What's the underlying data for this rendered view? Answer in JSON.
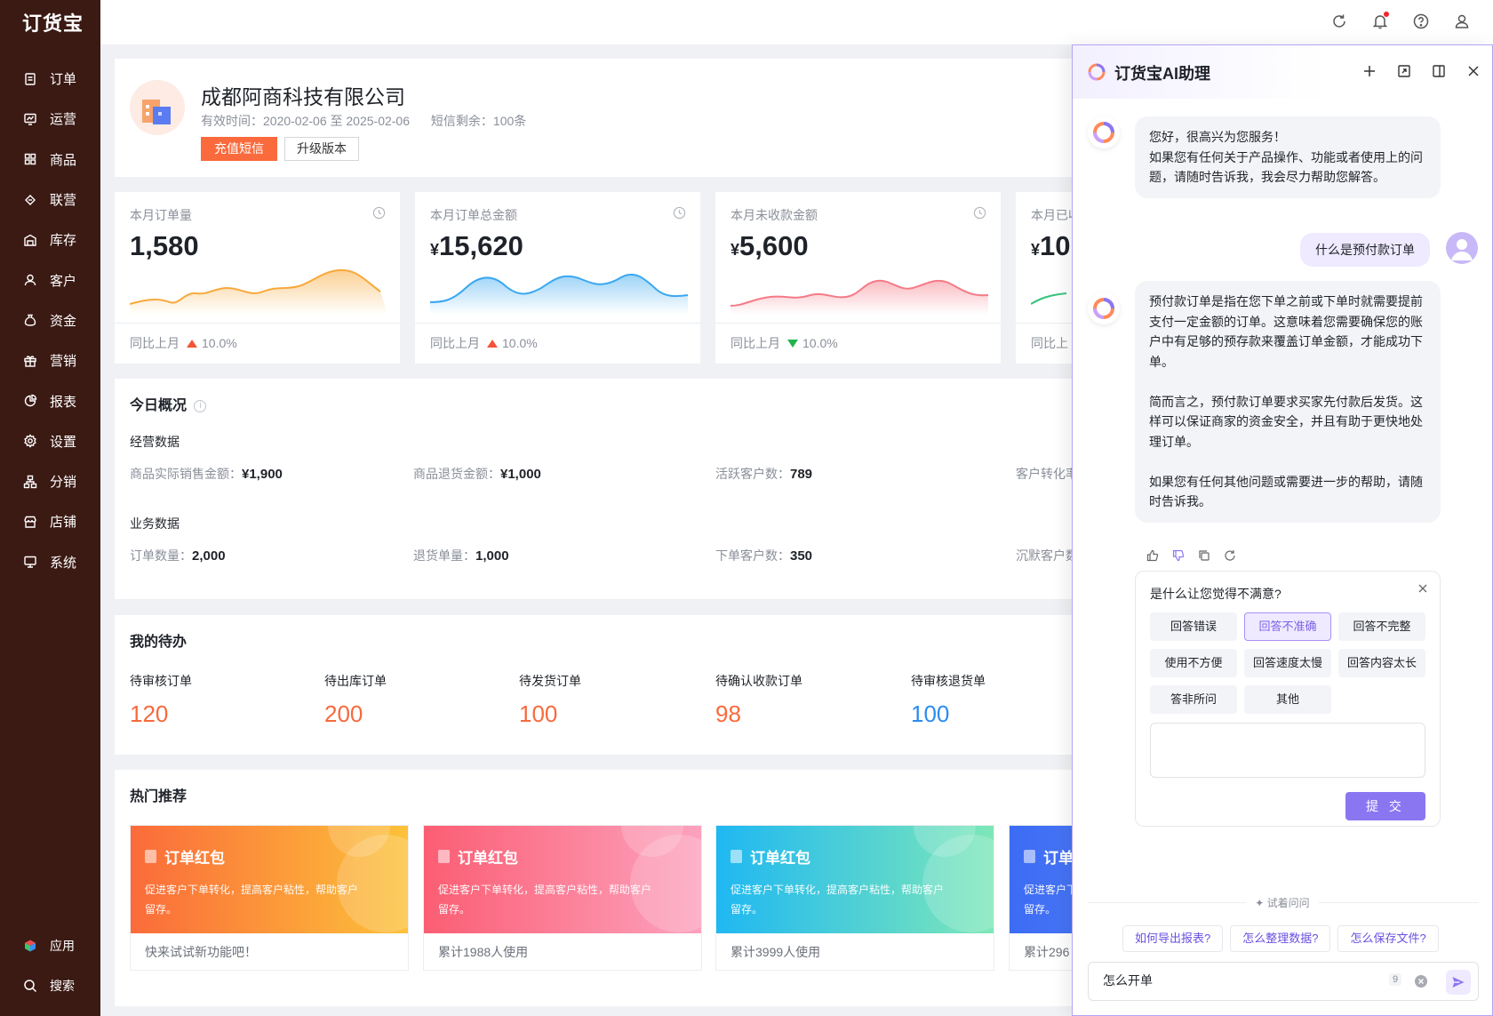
{
  "app": {
    "logo": "订货宝"
  },
  "sidebar": {
    "items": [
      {
        "label": "订单",
        "icon": "order-icon"
      },
      {
        "label": "运营",
        "icon": "operation-icon"
      },
      {
        "label": "商品",
        "icon": "goods-icon"
      },
      {
        "label": "联营",
        "icon": "joint-icon"
      },
      {
        "label": "库存",
        "icon": "warehouse-icon"
      },
      {
        "label": "客户",
        "icon": "customer-icon"
      },
      {
        "label": "资金",
        "icon": "money-bag-icon"
      },
      {
        "label": "营销",
        "icon": "gift-icon"
      },
      {
        "label": "报表",
        "icon": "pie-chart-icon"
      },
      {
        "label": "设置",
        "icon": "gear-icon"
      },
      {
        "label": "分销",
        "icon": "distribution-icon"
      },
      {
        "label": "店铺",
        "icon": "shop-icon"
      },
      {
        "label": "系统",
        "icon": "monitor-icon"
      }
    ],
    "bottom": [
      {
        "label": "应用",
        "icon": "apps-cube-icon"
      },
      {
        "label": "搜索",
        "icon": "search-icon"
      }
    ]
  },
  "topbar": {
    "icons": [
      "refresh-icon",
      "bell-icon",
      "help-icon",
      "user-icon"
    ]
  },
  "company": {
    "name": "成都阿商科技有限公司",
    "valid_time": "有效时间：2020-02-06 至 2025-02-06",
    "sms_left": "短信剩余：100条",
    "recharge_btn": "充值短信",
    "upgrade_btn": "升级版本"
  },
  "stats": [
    {
      "label": "本月订单量",
      "value": "1,580",
      "prefix": "",
      "compare": "同比上月",
      "trend": "up",
      "pct": "10.0%",
      "color": "#f7a93b"
    },
    {
      "label": "本月订单总金额",
      "value": "15,620",
      "prefix": "¥",
      "compare": "同比上月",
      "trend": "up",
      "pct": "10.0%",
      "color": "#3aa7f0"
    },
    {
      "label": "本月未收款金额",
      "value": "5,600",
      "prefix": "¥",
      "compare": "同比上月",
      "trend": "down",
      "pct": "10.0%",
      "color": "#f57a86"
    },
    {
      "label": "本月已收",
      "value": "10",
      "prefix": "¥",
      "compare": "同比上",
      "trend": "up",
      "pct": "",
      "color": "#33c27a"
    }
  ],
  "today": {
    "title": "今日概况",
    "business_title": "经营数据",
    "business": [
      {
        "label": "商品实际销售金额：",
        "value": "¥1,900"
      },
      {
        "label": "商品退货金额：",
        "value": "¥1,000"
      },
      {
        "label": "活跃客户数：",
        "value": "789"
      },
      {
        "label": "客户转化率",
        "value": ""
      }
    ],
    "service_title": "业务数据",
    "service": [
      {
        "label": "订单数量：",
        "value": "2,000"
      },
      {
        "label": "退货单量：",
        "value": "1,000"
      },
      {
        "label": "下单客户数：",
        "value": "350"
      },
      {
        "label": "沉默客户数",
        "value": ""
      }
    ]
  },
  "todo": {
    "title": "我的待办",
    "items": [
      {
        "label": "待审核订单",
        "value": "120",
        "color": "#f76a3c"
      },
      {
        "label": "待出库订单",
        "value": "200",
        "color": "#f76a3c"
      },
      {
        "label": "待发货订单",
        "value": "100",
        "color": "#f76a3c"
      },
      {
        "label": "待确认收款订单",
        "value": "98",
        "color": "#f76a3c"
      },
      {
        "label": "待审核退货单",
        "value": "100",
        "color": "#2b8cf2"
      }
    ]
  },
  "hot": {
    "title": "热门推荐",
    "cards": [
      {
        "title": "订单红包",
        "desc": "促进客户下单转化，提高客户粘性，帮助客户留存。",
        "foot": "快来试试新功能吧！"
      },
      {
        "title": "订单红包",
        "desc": "促进客户下单转化，提高客户粘性，帮助客户留存。",
        "foot": "累计1988人使用"
      },
      {
        "title": "订单红包",
        "desc": "促进客户下单转化，提高客户粘性，帮助客户留存。",
        "foot": "累计3999人使用"
      },
      {
        "title": "订单",
        "desc": "促进客户下单转化，提高客户粘性，帮助客户留存。",
        "foot": "累计296"
      }
    ]
  },
  "ai": {
    "title": "订货宝AI助理",
    "greeting": "您好，很高兴为您服务！\n如果您有任何关于产品操作、功能或者使用上的问题，请随时告诉我，我会尽力帮助您解答。",
    "user_question": "什么是预付款订单",
    "answer": "预付款订单是指在您下单之前或下单时就需要提前支付一定金额的订单。这意味着您需要确保您的账户中有足够的预存款来覆盖订单金额，才能成功下单。\n\n简而言之，预付款订单要求买家先付款后发货。这样可以保证商家的资金安全，并且有助于更快地处理订单。\n\n如果您有任何其他问题或需要进一步的帮助，请随时告诉我。",
    "feedback": {
      "title": "是什么让您觉得不满意?",
      "tags": [
        "回答错误",
        "回答不准确",
        "回答不完整",
        "使用不方便",
        "回答速度太慢",
        "回答内容太长",
        "答非所问",
        "其他"
      ],
      "selected": "回答不准确",
      "submit": "提 交"
    },
    "try_label": "✦ 试着问问",
    "suggestions": [
      "如何导出报表?",
      "怎么整理数据?",
      "怎么保存文件?"
    ],
    "input_value": "怎么开单",
    "char_count": "9"
  }
}
